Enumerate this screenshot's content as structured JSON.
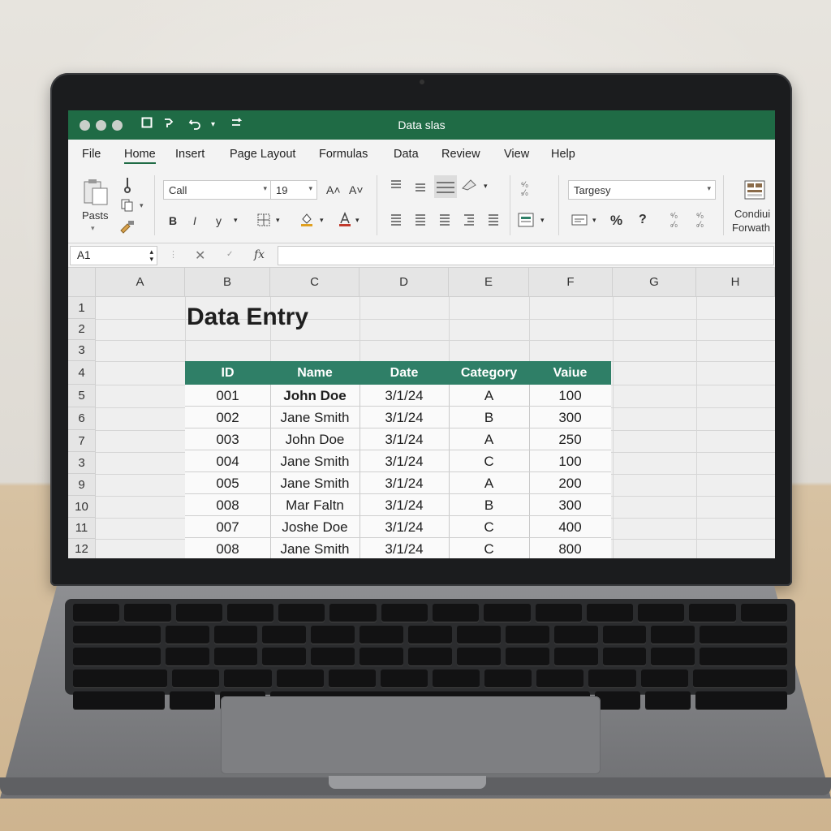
{
  "window": {
    "title": "Data slas"
  },
  "menu": [
    "File",
    "Home",
    "Insert",
    "Page Layout",
    "Formulas",
    "Data",
    "Review",
    "View",
    "Help"
  ],
  "ribbon": {
    "paste_label": "Pasts",
    "font_name": "Call",
    "font_size": "19",
    "style_box": "Targesy",
    "conditional_label_1": "Condiui",
    "conditional_label_2": "Forwath",
    "bold": "B",
    "italic": "I",
    "underline": "y",
    "percent": "%",
    "question": "?",
    "grow_font": "A˄",
    "shrink_font": "A˅"
  },
  "formula_bar": {
    "name_box": "A1",
    "cancel": "✕",
    "enter": "✓",
    "fx": "fx"
  },
  "columns": [
    "A",
    "B",
    "C",
    "D",
    "E",
    "F",
    "G",
    "H"
  ],
  "rows": [
    "1",
    "2",
    "3",
    "4",
    "5",
    "6",
    "7",
    "3",
    "9",
    "10",
    "11",
    "12"
  ],
  "sheet": {
    "heading": "Data Entry",
    "table_headers": [
      "ID",
      "Name",
      "Date",
      "Category",
      "Vaiue"
    ],
    "table_rows": [
      [
        "001",
        "John Doe",
        "3/1/24",
        "A",
        "100"
      ],
      [
        "002",
        "Jane Smith",
        "3/1/24",
        "B",
        "300"
      ],
      [
        "003",
        "John Doe",
        "3/1/24",
        "A",
        "250"
      ],
      [
        "004",
        "Jane Smith",
        "3/1/24",
        "C",
        "100"
      ],
      [
        "005",
        "Jane Smith",
        "3/1/24",
        "A",
        "200"
      ],
      [
        "008",
        "Mar Faltn",
        "3/1/24",
        "B",
        "300"
      ],
      [
        "007",
        "Joshe Doe",
        "3/1/24",
        "C",
        "400"
      ],
      [
        "008",
        "Jane Smith",
        "3/1/24",
        "C",
        "800"
      ]
    ]
  },
  "colors": {
    "titlebar": "#1f6b45",
    "table_header": "#2f7f67"
  }
}
